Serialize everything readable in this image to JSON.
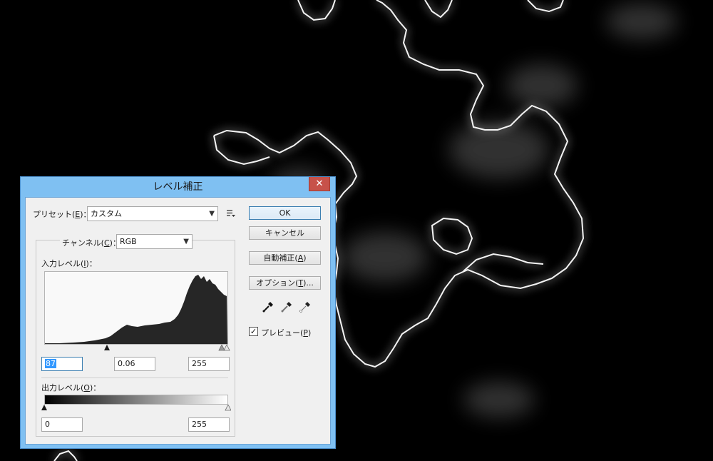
{
  "dialog": {
    "title": "レベル補正",
    "close": "✕",
    "preset": {
      "label_pre": "プリセット(",
      "label_key": "E",
      "label_post": ")：",
      "value": "カスタム",
      "menu_icon": "preset-options-icon"
    },
    "channel": {
      "label_pre": "チャンネル(",
      "label_key": "C",
      "label_post": ")：",
      "value": "RGB"
    },
    "input_levels": {
      "label_pre": "入力レベル(",
      "label_key": "I",
      "label_post": ")：",
      "black": "87",
      "gamma": "0.06",
      "white": "255"
    },
    "output_levels": {
      "label_pre": "出力レベル(",
      "label_key": "O",
      "label_post": ")：",
      "black": "0",
      "white": "255"
    },
    "buttons": {
      "ok": "OK",
      "cancel": "キャンセル",
      "auto_pre": "自動補正(",
      "auto_key": "A",
      "auto_post": ")",
      "options_pre": "オプション(",
      "options_key": "T",
      "options_post": ")..."
    },
    "preview": {
      "label_pre": "プレビュー(",
      "label_key": "P",
      "label_post": ")",
      "checked": "✓"
    },
    "icons": [
      "black-point-eyedropper-icon",
      "gray-point-eyedropper-icon",
      "white-point-eyedropper-icon"
    ]
  },
  "colors": {
    "titlebar": "#7fc0f2",
    "close": "#c7524a",
    "histogram": "#262626"
  }
}
